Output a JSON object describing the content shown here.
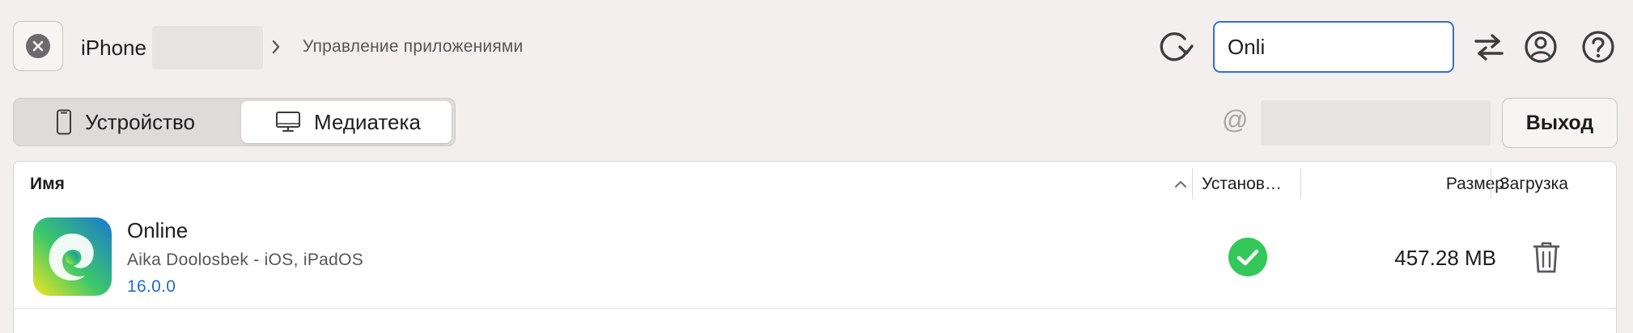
{
  "topbar": {
    "device_name": "iPhone",
    "breadcrumb": "Управление приложениями",
    "search": {
      "value": "Onli",
      "placeholder": ""
    },
    "icons": [
      "close-icon",
      "refresh-icon",
      "swap-icon",
      "account-icon",
      "help-icon"
    ]
  },
  "segments": {
    "device_label": "Устройство",
    "library_label": "Медиатека",
    "selected": "library"
  },
  "account": {
    "logout_label": "Выход"
  },
  "table": {
    "columns": {
      "name": "Имя",
      "installed": "Установ…",
      "size": "Размер",
      "download": "Загрузка"
    },
    "rows": [
      {
        "name": "Online",
        "developer": "Aika Doolosbek - iOS, iPadOS",
        "version": "16.0.0",
        "installed": true,
        "size": "457.28 MB"
      }
    ]
  },
  "colors": {
    "accent": "#2f6fd6",
    "version_link": "#1f6bd6",
    "installed_green": "#34c759",
    "background": "#f2efee"
  }
}
